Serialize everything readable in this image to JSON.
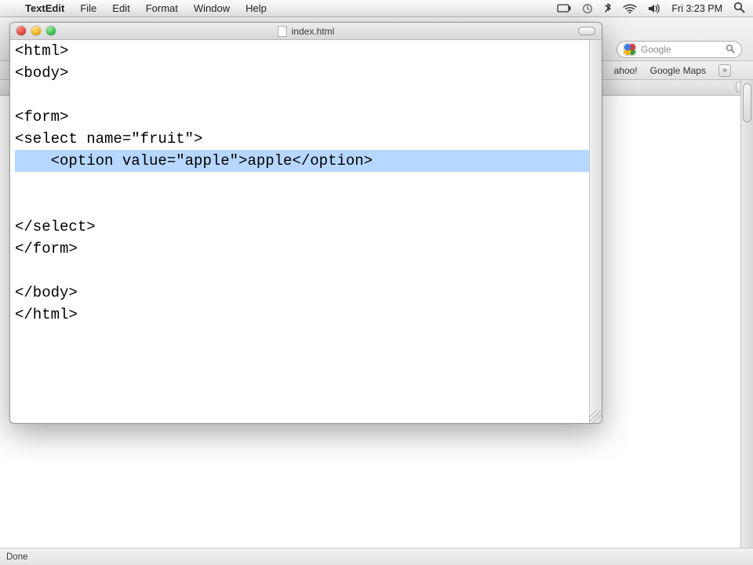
{
  "menubar": {
    "app": "TextEdit",
    "items": [
      "File",
      "Edit",
      "Format",
      "Window",
      "Help"
    ],
    "clock": "Fri 3:23 PM"
  },
  "browser": {
    "search_placeholder": "Google",
    "bookmarks": [
      "ahoo!",
      "Google Maps"
    ]
  },
  "window": {
    "title": "index.html"
  },
  "editor": {
    "lines": [
      "<html>",
      "<body>",
      "",
      "<form>",
      "<select name=\"fruit\">",
      "    <option value=\"apple\">apple</option>",
      "",
      "",
      "</select>",
      "</form>",
      "",
      "</body>",
      "</html>"
    ],
    "selected_line_index": 5
  },
  "statusbar": {
    "text": "Done"
  }
}
